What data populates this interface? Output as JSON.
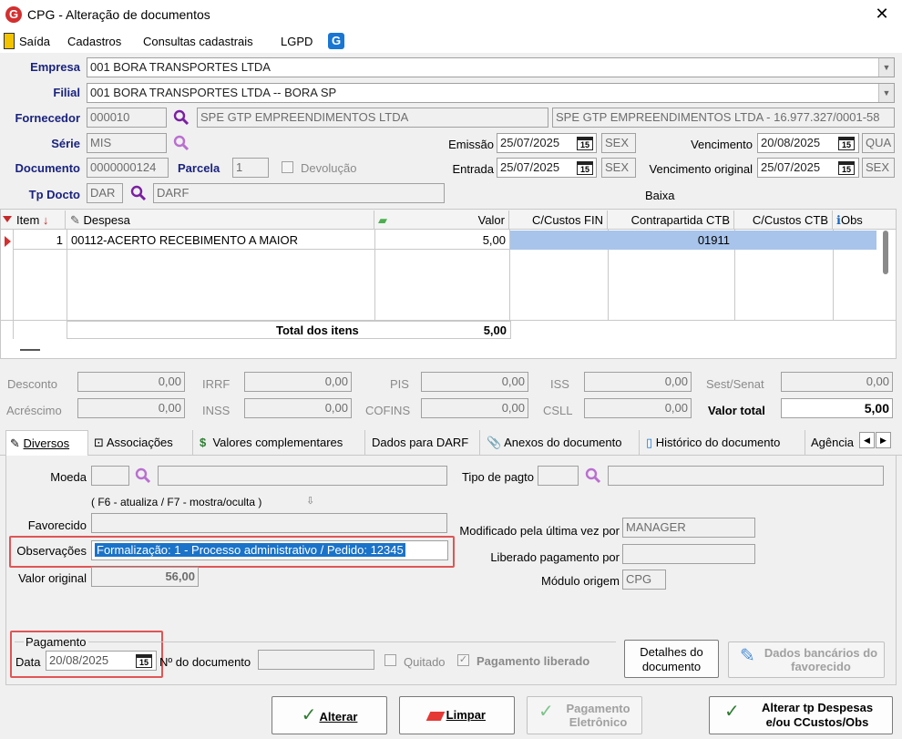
{
  "window": {
    "title": "CPG - Alteração de documentos"
  },
  "menu": [
    "Saída",
    "Cadastros",
    "Consultas cadastrais",
    "LGPD"
  ],
  "header": {
    "empresa_label": "Empresa",
    "empresa_value": "001 BORA TRANSPORTES LTDA",
    "filial_label": "Filial",
    "filial_value": "001 BORA TRANSPORTES LTDA -- BORA SP",
    "fornecedor_label": "Fornecedor",
    "fornecedor_code": "000010",
    "fornecedor_name": "SPE GTP EMPREENDIMENTOS LTDA",
    "fornecedor_full": "SPE GTP EMPREENDIMENTOS LTDA - 16.977.327/0001-58",
    "serie_label": "Série",
    "serie_value": "MIS",
    "documento_label": "Documento",
    "documento_value": "0000000124",
    "parcela_label": "Parcela",
    "parcela_value": "1",
    "devolucao_label": "Devolução",
    "tpdocto_label": "Tp Docto",
    "tpdocto_code": "DAR",
    "tpdocto_name": "DARF",
    "emissao_label": "Emissão",
    "emissao_date": "25/07/2025",
    "emissao_day": "SEX",
    "entrada_label": "Entrada",
    "entrada_date": "25/07/2025",
    "entrada_day": "SEX",
    "vencimento_label": "Vencimento",
    "vencimento_date": "20/08/2025",
    "vencimento_day": "QUA",
    "venc_orig_label": "Vencimento original",
    "venc_orig_date": "25/07/2025",
    "venc_orig_day": "SEX",
    "baixa_label": "Baixa",
    "cal_num": "15"
  },
  "grid": {
    "columns": [
      "Item",
      "Despesa",
      "Valor",
      "C/Custos FIN",
      "Contrapartida CTB",
      "C/Custos CTB",
      "Obs"
    ],
    "rows": [
      {
        "item": "1",
        "despesa": "00112-ACERTO RECEBIMENTO A MAIOR",
        "valor": "5,00",
        "ccfin": "",
        "contrapartida": "01911",
        "ccctb": ""
      }
    ],
    "total_label": "Total dos itens",
    "total_value": "5,00"
  },
  "taxes": {
    "desconto_label": "Desconto",
    "desconto": "0,00",
    "acrescimo_label": "Acréscimo",
    "acrescimo": "0,00",
    "irrf_label": "IRRF",
    "irrf": "0,00",
    "inss_label": "INSS",
    "inss": "0,00",
    "pis_label": "PIS",
    "pis": "0,00",
    "cofins_label": "COFINS",
    "cofins": "0,00",
    "iss_label": "ISS",
    "iss": "0,00",
    "csll_label": "CSLL",
    "csll": "0,00",
    "sest_label": "Sest/Senat",
    "sest": "0,00",
    "total_label": "Valor total",
    "total": "5,00"
  },
  "tabs": [
    "Diversos",
    "Associações",
    "Valores complementares",
    "Dados para DARF",
    "Anexos do documento",
    "Histórico do documento",
    "Agência"
  ],
  "diversos": {
    "moeda_label": "Moeda",
    "tipo_pagto_label": "Tipo de pagto",
    "hint": "( F6 - atualiza / F7 - mostra/oculta )",
    "favorecido_label": "Favorecido",
    "observacoes_label": "Observações",
    "observacoes_value": "Formalização: 1 - Processo administrativo / Pedido: 12345",
    "valor_original_label": "Valor original",
    "valor_original": "56,00",
    "modificado_label": "Modificado pela última vez por",
    "modificado_value": "MANAGER",
    "liberado_label": "Liberado pagamento por",
    "liberado_value": "",
    "modulo_label": "Módulo origem",
    "modulo_value": "CPG",
    "pagamento_group": "Pagamento",
    "data_label": "Data",
    "data_value": "20/08/2025",
    "ndoc_label": "Nº do documento",
    "quitado_label": "Quitado",
    "pag_liberado_label": "Pagamento liberado",
    "detalhes_btn": "Detalhes do documento",
    "dados_bancarios_btn": "Dados bancários do favorecido"
  },
  "buttons": {
    "alterar": "Alterar",
    "limpar": "Limpar",
    "pag_eletronico": "Pagamento Eletrônico",
    "alterar_tp_line1": "Alterar tp Despesas",
    "alterar_tp_line2": "e/ou CCustos/Obs"
  }
}
